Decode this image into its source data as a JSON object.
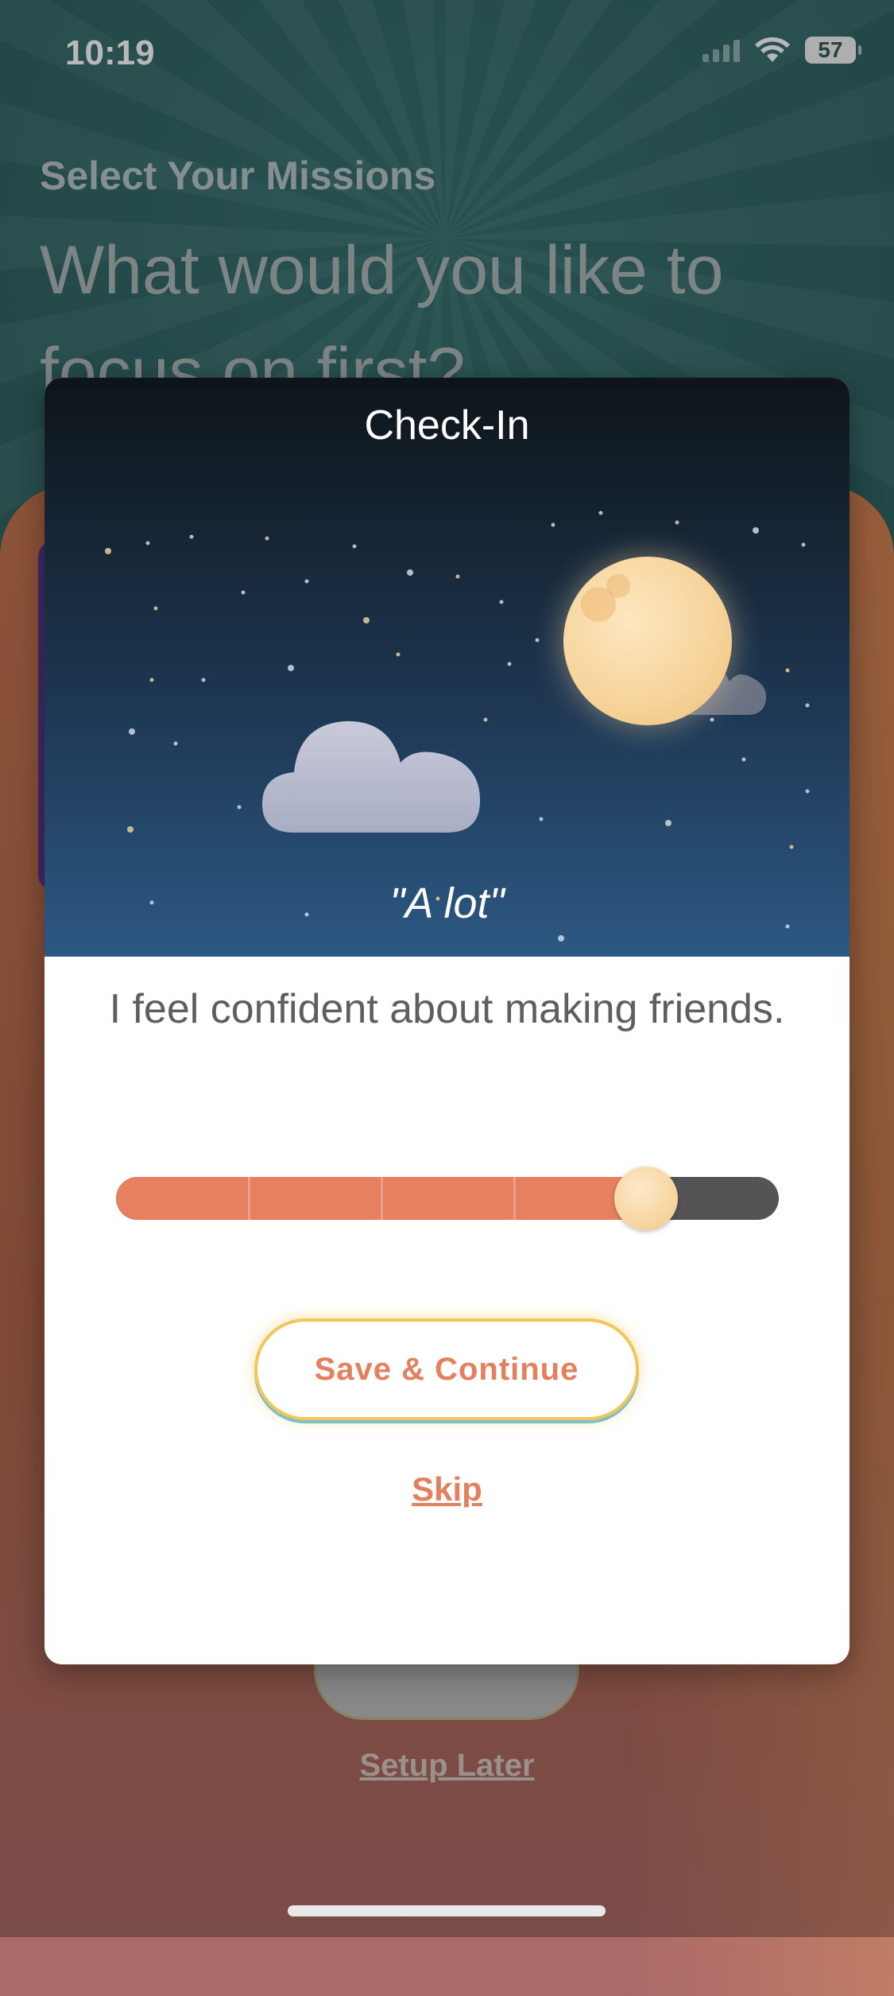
{
  "status_bar": {
    "time": "10:19",
    "battery": "57"
  },
  "background": {
    "subtitle": "Select Your Missions",
    "title": "What would you like to focus on first?",
    "setup_later": "Setup Later"
  },
  "modal": {
    "title": "Check-In",
    "answer_quote": "\"A lot\"",
    "question": "I feel confident about making friends.",
    "slider": {
      "value": 0.8,
      "steps": 5
    },
    "save_label": "Save & Continue",
    "skip_label": "Skip"
  },
  "colors": {
    "accent": "#e5805e",
    "slider_track": "#555355",
    "night_top": "#0e1419",
    "night_bottom": "#2c5883",
    "moon": "#f6d39a"
  }
}
